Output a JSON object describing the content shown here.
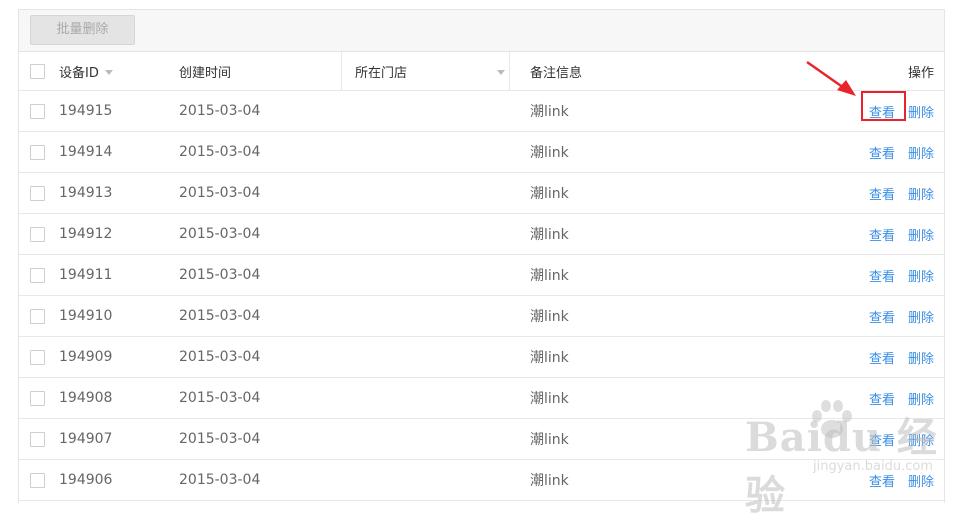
{
  "toolbar": {
    "batch_delete_label": "批量删除"
  },
  "table": {
    "headers": {
      "device_id": "设备ID",
      "created_time": "创建时间",
      "store": "所在门店",
      "note": "备注信息",
      "ops": "操作"
    },
    "view_label": "查看",
    "delete_label": "删除",
    "rows": [
      {
        "id": "194915",
        "time": "2015-03-04",
        "store": "",
        "note": "潮link"
      },
      {
        "id": "194914",
        "time": "2015-03-04",
        "store": "",
        "note": "潮link"
      },
      {
        "id": "194913",
        "time": "2015-03-04",
        "store": "",
        "note": "潮link"
      },
      {
        "id": "194912",
        "time": "2015-03-04",
        "store": "",
        "note": "潮link"
      },
      {
        "id": "194911",
        "time": "2015-03-04",
        "store": "",
        "note": "潮link"
      },
      {
        "id": "194910",
        "time": "2015-03-04",
        "store": "",
        "note": "潮link"
      },
      {
        "id": "194909",
        "time": "2015-03-04",
        "store": "",
        "note": "潮link"
      },
      {
        "id": "194908",
        "time": "2015-03-04",
        "store": "",
        "note": "潮link"
      },
      {
        "id": "194907",
        "time": "2015-03-04",
        "store": "",
        "note": "潮link"
      },
      {
        "id": "194906",
        "time": "2015-03-04",
        "store": "",
        "note": "潮link"
      }
    ]
  },
  "watermark": {
    "brand": "Baidu 经验",
    "url": "jingyan.baidu.com"
  },
  "colors": {
    "link": "#3a8ee6",
    "highlight": "#e8232c",
    "header_bg": "#f7f7f7"
  }
}
